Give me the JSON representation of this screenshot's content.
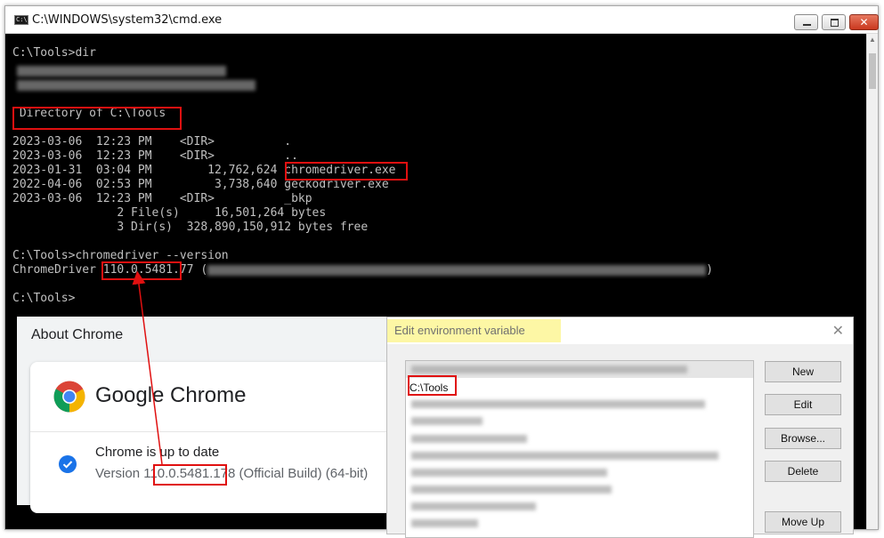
{
  "cmd": {
    "title": "C:\\WINDOWS\\system32\\cmd.exe",
    "icon_label": "C:\\",
    "icon": "console-app-icon",
    "buttons": {
      "minimize": "minimize-icon",
      "maximize": "maximize-icon",
      "close": "close-icon",
      "close_glyph": "✕"
    },
    "lines": {
      "prompt_dir": "C:\\Tools>dir",
      "directory_of": " Directory of C:\\Tools",
      "row1": "2023-03-06  12:23 PM    <DIR>          .",
      "row2": "2023-03-06  12:23 PM    <DIR>          ..",
      "row3_prefix": "2023-01-31  03:04 PM        12,762,624 ",
      "row3_name": "chromedriver.exe",
      "row4": "2022-04-06  02:53 PM         3,738,640 geckodriver.exe",
      "row5": "2023-03-06  12:23 PM    <DIR>          _bkp",
      "files": "               2 File(s)     16,501,264 bytes",
      "dirs": "               3 Dir(s)  328,890,150,912 bytes free",
      "prompt_version": "C:\\Tools>chromedriver --version",
      "driver_prefix": "ChromeDriver ",
      "driver_version_hl": "110.0.5481",
      "driver_version_rest": ".77 (",
      "driver_suffix": ")",
      "prompt_end": "C:\\Tools>"
    }
  },
  "about_chrome": {
    "heading": "About Chrome",
    "product": "Google Chrome",
    "status": "Chrome is up to date",
    "version_prefix": "Version ",
    "version_hl": "110.0.5481",
    "version_rest": ".178 (Official Build) (64-bit)",
    "check_icon": "check-circle-icon",
    "logo_icon": "chrome-logo-icon"
  },
  "env_dialog": {
    "title": "Edit environment variable",
    "close_glyph": "✕",
    "selected_item": "C:\\Tools",
    "buttons": {
      "new": "New",
      "edit": "Edit",
      "browse": "Browse...",
      "delete": "Delete",
      "move_up": "Move Up"
    }
  },
  "colors": {
    "highlight_red": "#e01010",
    "title_highlight": "#fdf7a5",
    "console_bg": "#000000",
    "console_text": "#c0c0c0"
  }
}
